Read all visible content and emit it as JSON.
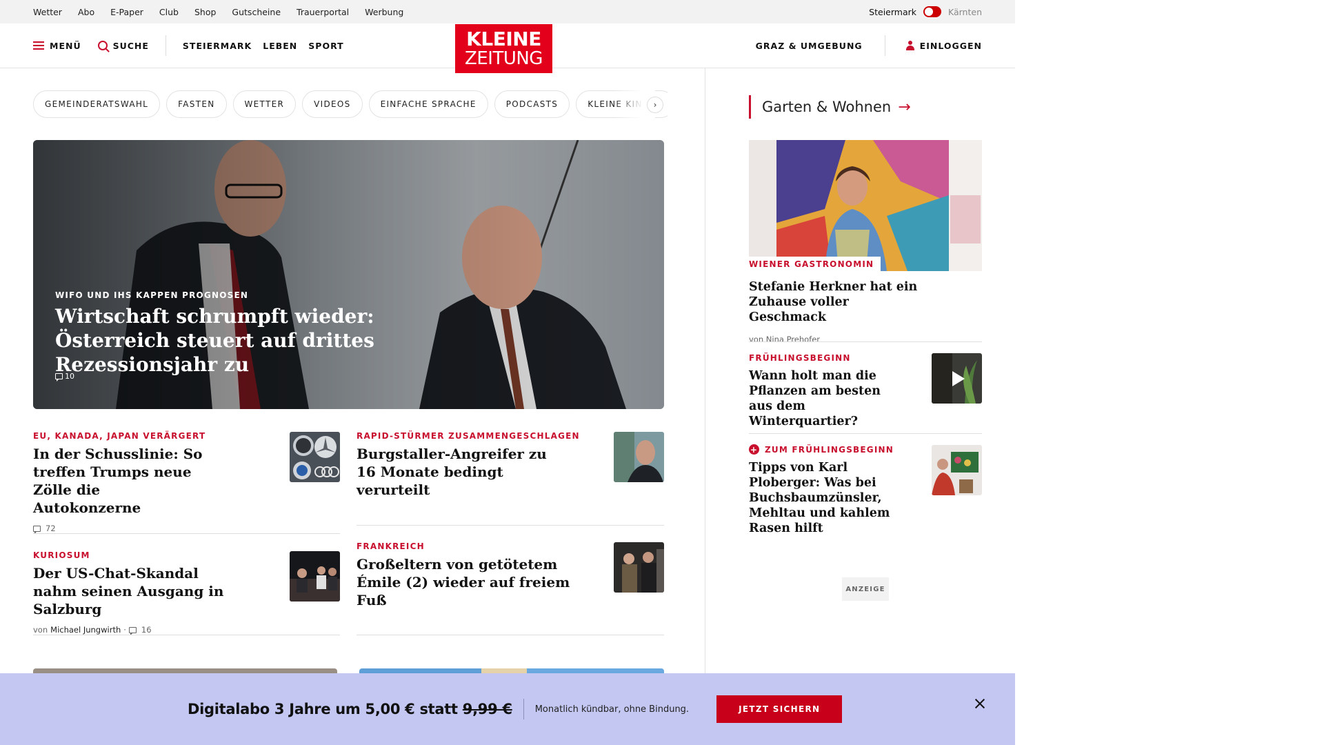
{
  "utility_nav": {
    "links": [
      "Wetter",
      "Abo",
      "E-Paper",
      "Club",
      "Shop",
      "Gutscheine",
      "Trauerportal",
      "Werbung"
    ],
    "region_active": "Steiermark",
    "region_inactive": "Kärnten"
  },
  "header": {
    "menu_label": "MENÜ",
    "search_label": "SUCHE",
    "sections": [
      "STEIERMARK",
      "LEBEN",
      "SPORT"
    ],
    "logo_line1": "KLEINE",
    "logo_line2": "ZEITUNG",
    "local_label": "GRAZ & UMGEBUNG",
    "login_label": "EINLOGGEN"
  },
  "tags": [
    "GEMEINDERATSWAHL",
    "FASTEN",
    "WETTER",
    "VIDEOS",
    "EINFACHE SPRACHE",
    "PODCASTS",
    "KLEINE KINDER"
  ],
  "hero": {
    "kicker": "WIFO UND IHS KAPPEN PROGNOSEN",
    "title": "Wirtschaft schrumpft wieder: Österreich steuert auf drittes Rezessionsjahr zu",
    "comments": "10"
  },
  "articles": [
    {
      "kicker": "EU, KANADA, JAPAN VERÄRGERT",
      "title": "In der Schusslinie: So treffen Trumps neue Zölle die Autokonzerne",
      "comments": "72"
    },
    {
      "kicker": "RAPID-STÜRMER ZUSAMMENGESCHLAGEN",
      "title": "Burgstaller-Angreifer zu 16 Monate bedingt verurteilt"
    },
    {
      "kicker": "KURIOSUM",
      "title": "Der US-Chat-Skandal nahm seinen Ausgang in Salzburg",
      "author_prefix": "von",
      "author": "Michael Jungwirth",
      "separator": "·",
      "comments": "16"
    },
    {
      "kicker": "FRANKREICH",
      "title": "Großeltern von getötetem Émile (2) wieder auf freiem Fuß"
    }
  ],
  "sidebar": {
    "heading": "Garten & Wohnen",
    "heading_arrow": "→",
    "feature": {
      "kicker": "WIENER GASTRONOMIN",
      "title": "Stefanie Herkner hat ein Zuhause voller Geschmack",
      "author_line": "von Nina Prehofer"
    },
    "items": [
      {
        "kicker": "FRÜHLINGSBEGINN",
        "title": "Wann holt man die Pflanzen am besten aus dem Winterquartier?"
      },
      {
        "kicker": "ZUM FRÜHLINGSBEGINN",
        "title": "Tipps von Karl Ploberger: Was bei Buchsbaumzünsler, Mehltau und kahlem Rasen hilft"
      }
    ],
    "ad_label": "ANZEIGE"
  },
  "promo": {
    "title_main": "Digitalabo 3 Jahre um 5,00 € statt",
    "title_old_price": "9,99 €",
    "subtitle": "Monatlich kündbar, ohne Bindung.",
    "button": "JETZT SICHERN"
  },
  "colors": {
    "brand_red": "#e2001a",
    "accent_red": "#c8102e",
    "promo_bg": "#c3c7f2"
  },
  "icons": [
    "hamburger-icon",
    "search-icon",
    "user-icon",
    "comment-icon",
    "chevron-right-icon",
    "arrow-right-icon",
    "play-icon",
    "plus-icon",
    "close-icon"
  ]
}
